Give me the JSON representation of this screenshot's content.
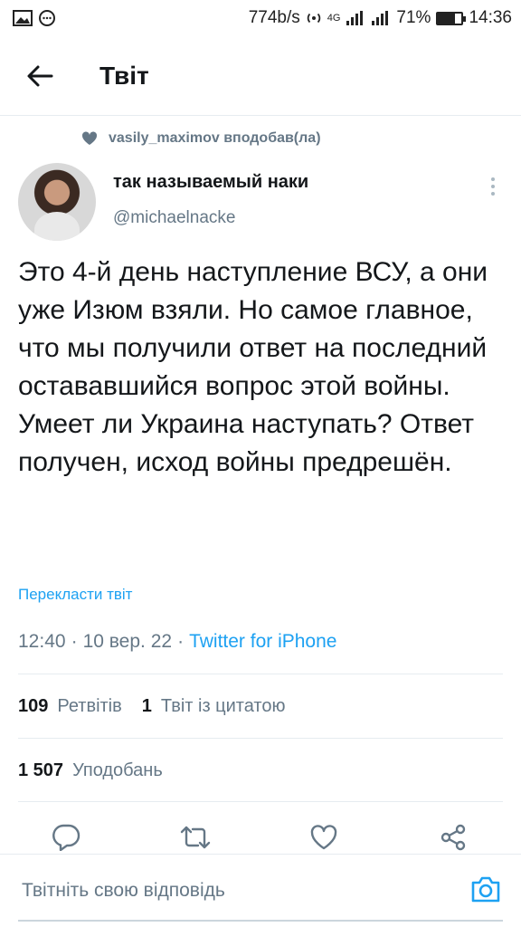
{
  "status_bar": {
    "speed": "774b/s",
    "network": "4G",
    "battery": "71%",
    "battery_level": 0.71,
    "time": "14:36"
  },
  "header": {
    "title": "Твіт",
    "back_icon": "arrow-left-icon"
  },
  "social_context": {
    "icon": "heart-icon",
    "text": "vasily_maximov вподобав(ла)"
  },
  "author": {
    "name": "так называемый наки",
    "handle": "@michaelnacke"
  },
  "tweet": {
    "text": "Это 4-й день наступление ВСУ, а они уже Изюм взяли. Но самое главное, что мы получили ответ на последний остававшийся вопрос этой войны. Умеет ли Украина наступать? Ответ получен, исход войны предрешён.",
    "translate_label": "Перекласти твіт",
    "time": "12:40",
    "date": "10 вер. 22",
    "separator": "·",
    "source": "Twitter for iPhone"
  },
  "stats": {
    "retweets_count": "109",
    "retweets_label": "Ретвітів",
    "quotes_count": "1",
    "quotes_label": "Твіт із цитатою",
    "likes_count": "1 507",
    "likes_label": "Уподобань"
  },
  "actions": [
    "reply-icon",
    "retweet-icon",
    "like-icon",
    "share-icon"
  ],
  "reply": {
    "placeholder": "Твітніть свою відповідь",
    "camera_icon": "camera-icon"
  },
  "colors": {
    "accent": "#1da1f2",
    "secondary_text": "#657786",
    "primary_text": "#14171a"
  }
}
